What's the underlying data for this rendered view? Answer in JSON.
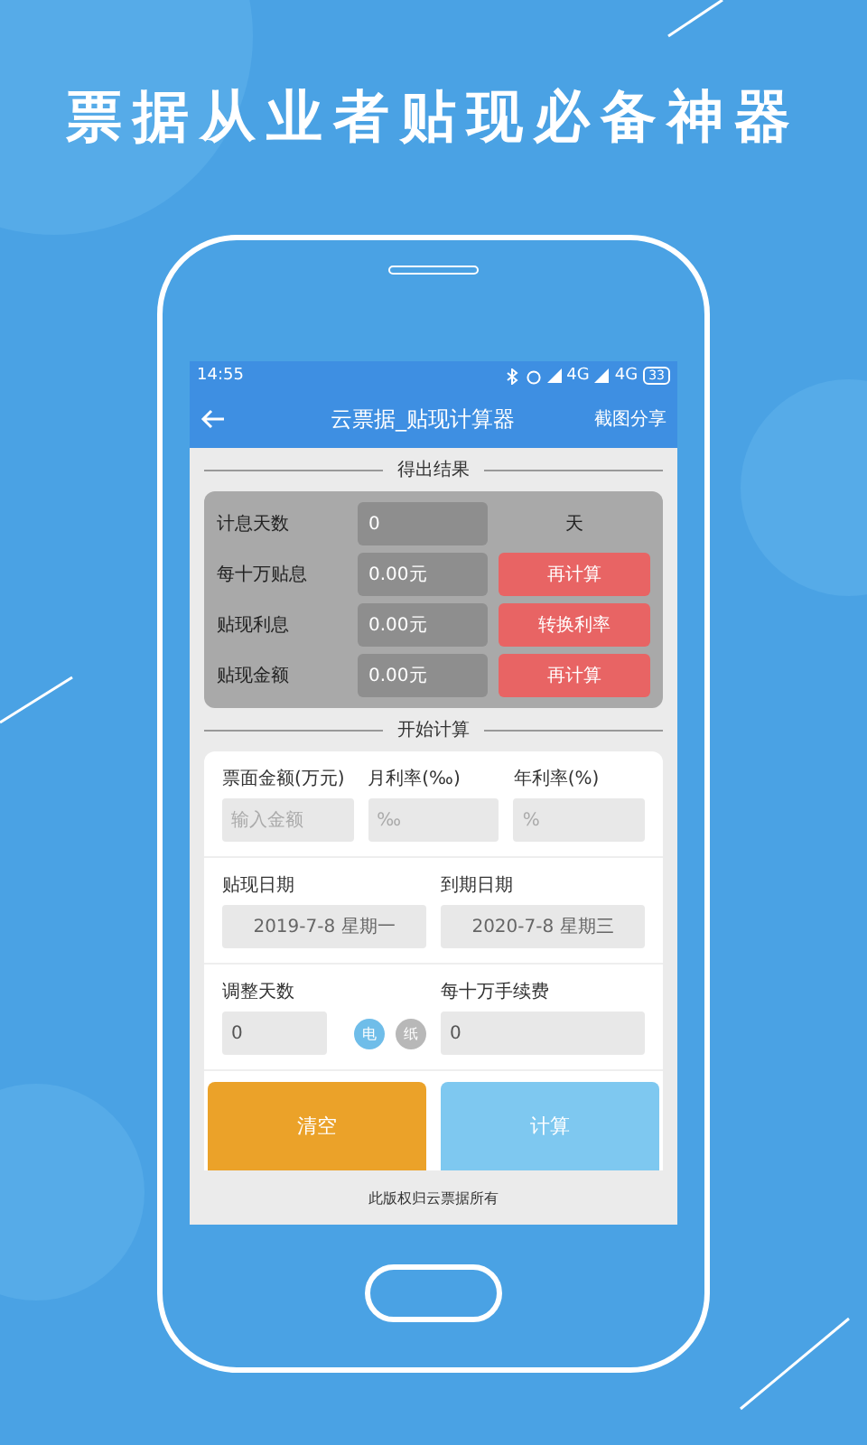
{
  "headline": "票据从业者贴现必备神器",
  "status_bar": {
    "time": "14:55",
    "networks": [
      "4G",
      "4G"
    ],
    "battery": "33"
  },
  "app_bar": {
    "title": "云票据_贴现计算器",
    "action": "截图分享"
  },
  "results": {
    "title": "得出结果",
    "rows": [
      {
        "label": "计息天数",
        "value": "0",
        "kind": "unit",
        "side": "天"
      },
      {
        "label": "每十万贴息",
        "value": "0.00元",
        "kind": "button",
        "side": "再计算"
      },
      {
        "label": "贴现利息",
        "value": "0.00元",
        "kind": "button",
        "side": "转换利率"
      },
      {
        "label": "贴现金额",
        "value": "0.00元",
        "kind": "button",
        "side": "再计算"
      }
    ]
  },
  "calc": {
    "title": "开始计算",
    "rate_fields": [
      {
        "label": "票面金额(万元)",
        "placeholder": "输入金额"
      },
      {
        "label": "月利率(‰)",
        "placeholder": "‰"
      },
      {
        "label": "年利率(%)",
        "placeholder": "%"
      }
    ],
    "date_fields": [
      {
        "label": "贴现日期",
        "value": "2019-7-8 星期一"
      },
      {
        "label": "到期日期",
        "value": "2020-7-8 星期三"
      }
    ],
    "adjust": {
      "label": "调整天数",
      "value": "0",
      "toggles": [
        {
          "label": "电",
          "selected": true
        },
        {
          "label": "纸",
          "selected": false
        }
      ]
    },
    "fee": {
      "label": "每十万手续费",
      "value": "0"
    },
    "buttons": [
      {
        "label": "清空",
        "kind": "clear"
      },
      {
        "label": "计算",
        "kind": "calculate"
      }
    ]
  },
  "footer": "此版权归云票据所有"
}
